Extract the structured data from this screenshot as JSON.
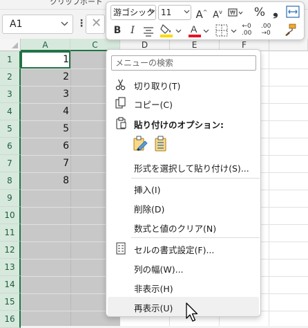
{
  "ribbon": {
    "group_label": "クリップボード"
  },
  "name_box": {
    "value": "A1"
  },
  "columns": [
    "A",
    "C",
    "D",
    "E",
    "F"
  ],
  "rows": [
    "1",
    "2",
    "3",
    "4",
    "5",
    "6",
    "7",
    "8",
    "9",
    "10",
    "11",
    "12",
    "13",
    "14",
    "15",
    "16"
  ],
  "cells_a": [
    "1",
    "2",
    "3",
    "4",
    "5",
    "6",
    "7",
    "8"
  ],
  "mini_toolbar": {
    "font_name": "游ゴシック",
    "font_size": "11",
    "grow_font": "A",
    "shrink_font": "A",
    "percent": "%",
    "comma": "❟",
    "bold": "B",
    "italic": "I",
    "fill_letter": "A",
    "fill_color": "#ffd800",
    "font_color": "#e81123",
    "inc_decimal_top": "←0",
    "inc_decimal_bottom": ".00",
    "dec_decimal_top": ".00",
    "dec_decimal_bottom": "→0"
  },
  "context_menu": {
    "search_placeholder": "メニューの検索",
    "items": [
      {
        "label": "切り取り(T)",
        "icon": "scissors-icon"
      },
      {
        "label": "コピー(C)",
        "icon": "copy-icon"
      },
      {
        "label": "貼り付けのオプション:",
        "icon": "clipboard-icon"
      },
      {
        "label": "形式を選択して貼り付け(S)...",
        "icon": ""
      },
      {
        "label": "挿入(I)",
        "icon": ""
      },
      {
        "label": "削除(D)",
        "icon": ""
      },
      {
        "label": "数式と値のクリア(N)",
        "icon": ""
      },
      {
        "label": "セルの書式設定(F)...",
        "icon": "format-cells-icon"
      },
      {
        "label": "列の幅(W)...",
        "icon": ""
      },
      {
        "label": "非表示(H)",
        "icon": ""
      },
      {
        "label": "再表示(U)",
        "icon": ""
      }
    ]
  }
}
